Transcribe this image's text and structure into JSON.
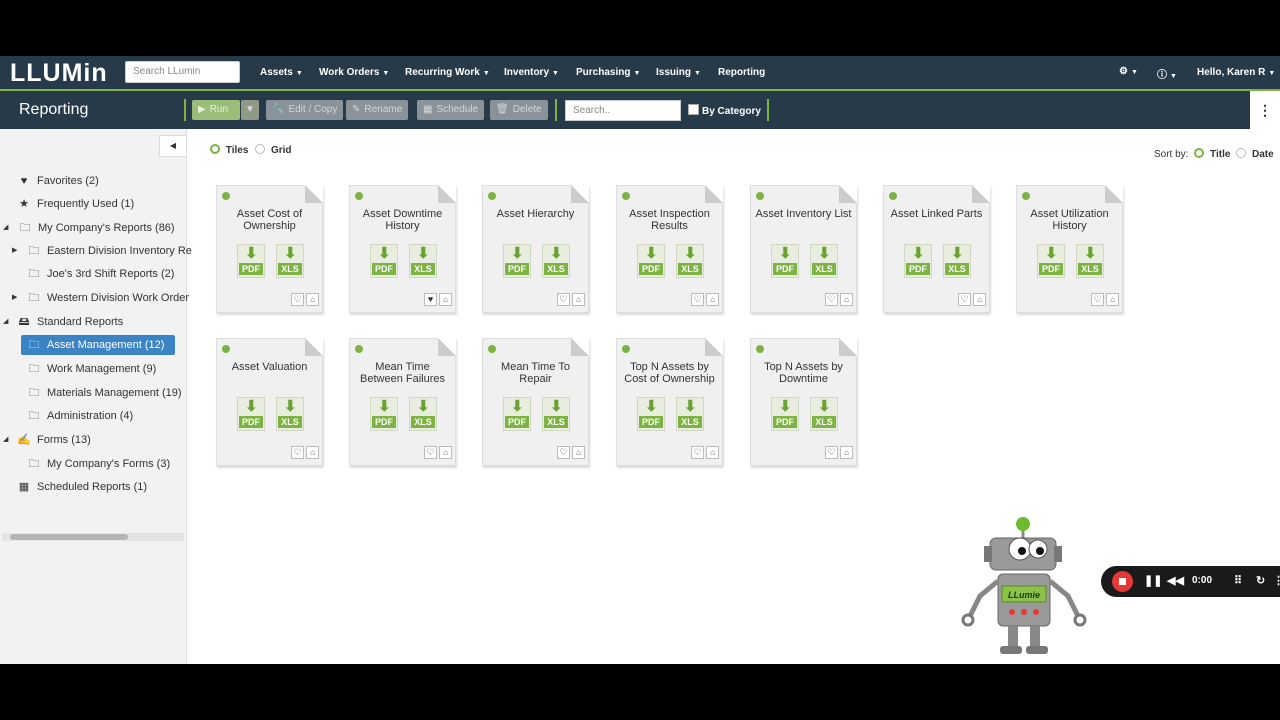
{
  "app": {
    "logo": "LLUMin",
    "search_placeholder": "Search LLumin",
    "menu": [
      "Assets",
      "Work Orders",
      "Recurring Work",
      "Inventory",
      "Purchasing",
      "Issuing"
    ],
    "reporting_link": "Reporting",
    "greeting": "Hello, Karen R"
  },
  "toolbar": {
    "title": "Reporting",
    "run": "Run",
    "edit_copy": "Edit / Copy",
    "rename": "Rename",
    "schedule": "Schedule",
    "delete": "Delete",
    "search_placeholder": "Search..",
    "by_category": "By Category"
  },
  "sidebar": {
    "items": [
      {
        "label": "Favorites (2)"
      },
      {
        "label": "Frequently Used (1)"
      },
      {
        "label": "My Company's Reports (86)"
      },
      {
        "label": "Eastern Division Inventory Re"
      },
      {
        "label": "Joe's 3rd Shift Reports (2)"
      },
      {
        "label": "Western Division Work Order"
      },
      {
        "label": "Standard Reports"
      },
      {
        "label": "Asset Management (12)"
      },
      {
        "label": "Work Management (9)"
      },
      {
        "label": "Materials Management (19)"
      },
      {
        "label": "Administration (4)"
      },
      {
        "label": "Forms (13)"
      },
      {
        "label": "My Company's Forms (3)"
      },
      {
        "label": "Scheduled Reports (1)"
      }
    ]
  },
  "view": {
    "tiles": "Tiles",
    "grid": "Grid",
    "sort_by": "Sort by:",
    "sort_title": "Title",
    "sort_date": "Date"
  },
  "download": {
    "pdf": "PDF",
    "xls": "XLS"
  },
  "reports": [
    {
      "title": "Asset Cost of Ownership",
      "favorite": false
    },
    {
      "title": "Asset Downtime History",
      "favorite": true
    },
    {
      "title": "Asset Hierarchy",
      "favorite": false
    },
    {
      "title": "Asset Inspection Results",
      "favorite": false
    },
    {
      "title": "Asset Inventory List",
      "favorite": false
    },
    {
      "title": "Asset Linked Parts",
      "favorite": false
    },
    {
      "title": "Asset Utilization History",
      "favorite": false
    },
    {
      "title": "Asset Valuation",
      "favorite": false
    },
    {
      "title": "Mean Time Between Failures",
      "favorite": false
    },
    {
      "title": "Mean Time To Repair",
      "favorite": false
    },
    {
      "title": "Top N Assets by Cost of Ownership",
      "favorite": false
    },
    {
      "title": "Top N Assets by Downtime",
      "favorite": false
    }
  ],
  "mascot": {
    "badge": "LLumie"
  },
  "recorder": {
    "time": "0:00"
  }
}
